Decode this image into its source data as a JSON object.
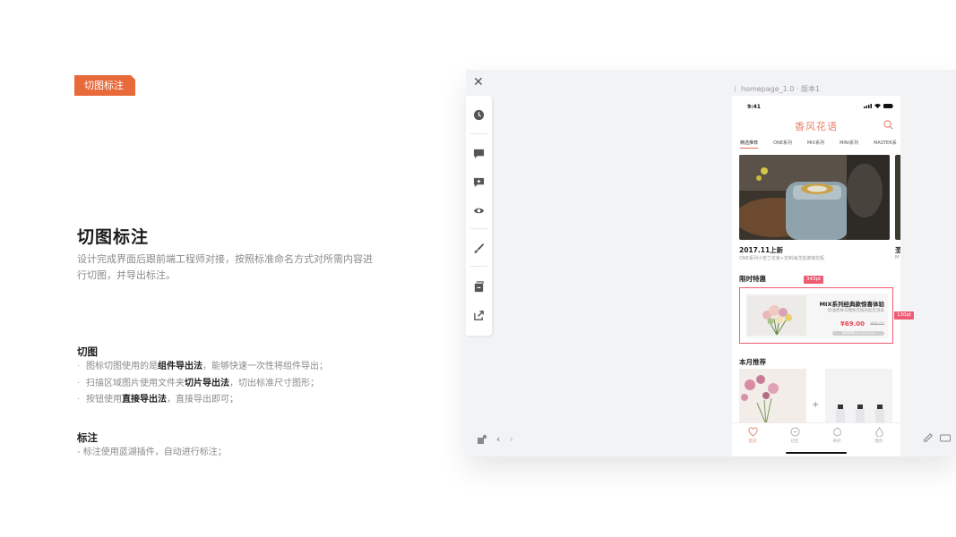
{
  "tag": {
    "label": "切图标注"
  },
  "heading": "切图标注",
  "description": "设计完成界面后跟前端工程师对接，按照标准命名方式对所需内容进行切图，并导出标注。",
  "slicing": {
    "title": "切图",
    "items": [
      {
        "pre": "图标切图使用的是",
        "bold": "组件导出法",
        "post": "，能够快速一次性将组件导出；"
      },
      {
        "pre": "扫描区域图片使用文件夹",
        "bold": "切片导出法",
        "post": "，切出标准尺寸图形；"
      },
      {
        "pre": "按钮使用",
        "bold": "直接导出法",
        "post": "，直接导出即可；"
      }
    ]
  },
  "annotation": {
    "title": "标注",
    "line": "- 标注使用蓝湖插件，自动进行标注；"
  },
  "window": {
    "artboard_name": "homepage_1.0 · 版本1",
    "close_icon": "close-icon",
    "toolbar_icons": [
      "clock-icon",
      "comment-icon",
      "add-comment-icon",
      "eye-icon",
      "brush-icon",
      "slice-icon",
      "share-icon"
    ]
  },
  "phone": {
    "time": "9:41",
    "brand": "香风花语",
    "tabs": [
      "精选推荐",
      "ONE系列",
      "MIX系列",
      "MINI系列",
      "MASTER系"
    ],
    "hero": {
      "title": "2017.11上新",
      "subtitle": "ONE系列小苍兰花束+定制海洋蓝玻璃花瓶",
      "next_title": "圣",
      "next_sub": "M"
    },
    "limited": {
      "title": "限时特惠",
      "product": "MIX系列经典款惊喜体验",
      "desc": "奶油客样与糖粉花瓶的起至温柔",
      "price": "¥69.00",
      "old_price": "¥99.00",
      "bar": "活动时间 12.12-12.14"
    },
    "measure": {
      "width": "343pt",
      "height": "130pt"
    },
    "monthly": {
      "title": "本月推荐",
      "plus": "+"
    },
    "tabbar": [
      "首页",
      "社区",
      "养护",
      "我的"
    ]
  },
  "colors": {
    "accent": "#e86a3b",
    "brand": "#e8826a",
    "measure": "#ee5c73"
  }
}
